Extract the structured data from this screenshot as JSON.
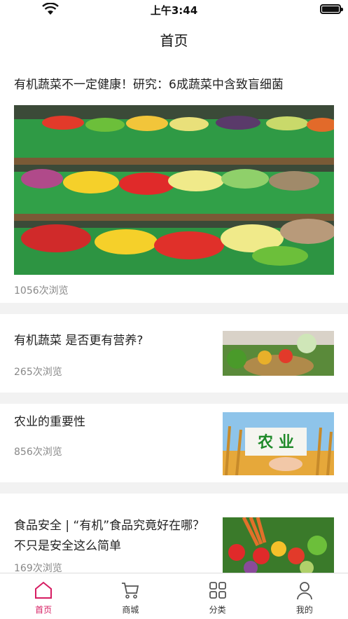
{
  "status_bar": {
    "time": "上午3:44"
  },
  "nav": {
    "title": "首页"
  },
  "feed": {
    "hero": {
      "headline": "有机蔬菜不一定健康！研究：6成蔬菜中含致盲细菌",
      "views": "1056次浏览"
    },
    "items": [
      {
        "headline": "有机蔬菜 是否更有营养?",
        "views": "265次浏览"
      },
      {
        "headline": "农业的重要性",
        "views": "856次浏览",
        "thumb_text": "农 业"
      },
      {
        "headline": "食品安全 | “有机”食品究竟好在哪？不只是安全这么简单",
        "views": "169次浏览"
      }
    ]
  },
  "tabs": [
    {
      "label": "首页",
      "icon": "home-icon",
      "active": true
    },
    {
      "label": "商城",
      "icon": "cart-icon",
      "active": false
    },
    {
      "label": "分类",
      "icon": "grid-icon",
      "active": false
    },
    {
      "label": "我的",
      "icon": "user-icon",
      "active": false
    }
  ],
  "colors": {
    "accent": "#d61d62",
    "background": "#f2f2f2"
  }
}
